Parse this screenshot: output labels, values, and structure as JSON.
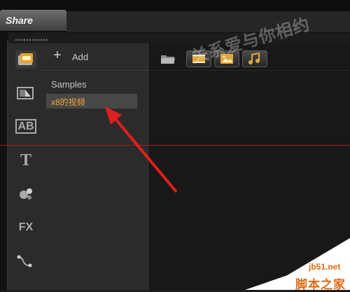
{
  "header": {
    "share_tab": "Share"
  },
  "library": {
    "add_label": "Add",
    "items": [
      {
        "label": "Samples",
        "selected": false
      },
      {
        "label": "x8的视频",
        "selected": true
      }
    ]
  },
  "sidebar": {
    "icons": [
      {
        "name": "media-library-icon",
        "active": true
      },
      {
        "name": "transition-icon"
      },
      {
        "name": "title-ab-icon",
        "text": "AB"
      },
      {
        "name": "text-icon",
        "text": "T"
      },
      {
        "name": "graphic-icon"
      },
      {
        "name": "filter-icon",
        "text": "FX"
      },
      {
        "name": "motion-path-icon"
      }
    ]
  },
  "toolbar": {
    "buttons": [
      "folder-icon",
      "video-filter-icon",
      "photo-filter-icon",
      "audio-filter-icon"
    ]
  },
  "watermark": {
    "diagonal": "关系爱与你相约",
    "site": "jb51.net",
    "brand": "脚本之家"
  },
  "colors": {
    "selection_text": "#f0a33a",
    "annotation_arrow": "#e0201c",
    "guide_line": "#b01818"
  }
}
